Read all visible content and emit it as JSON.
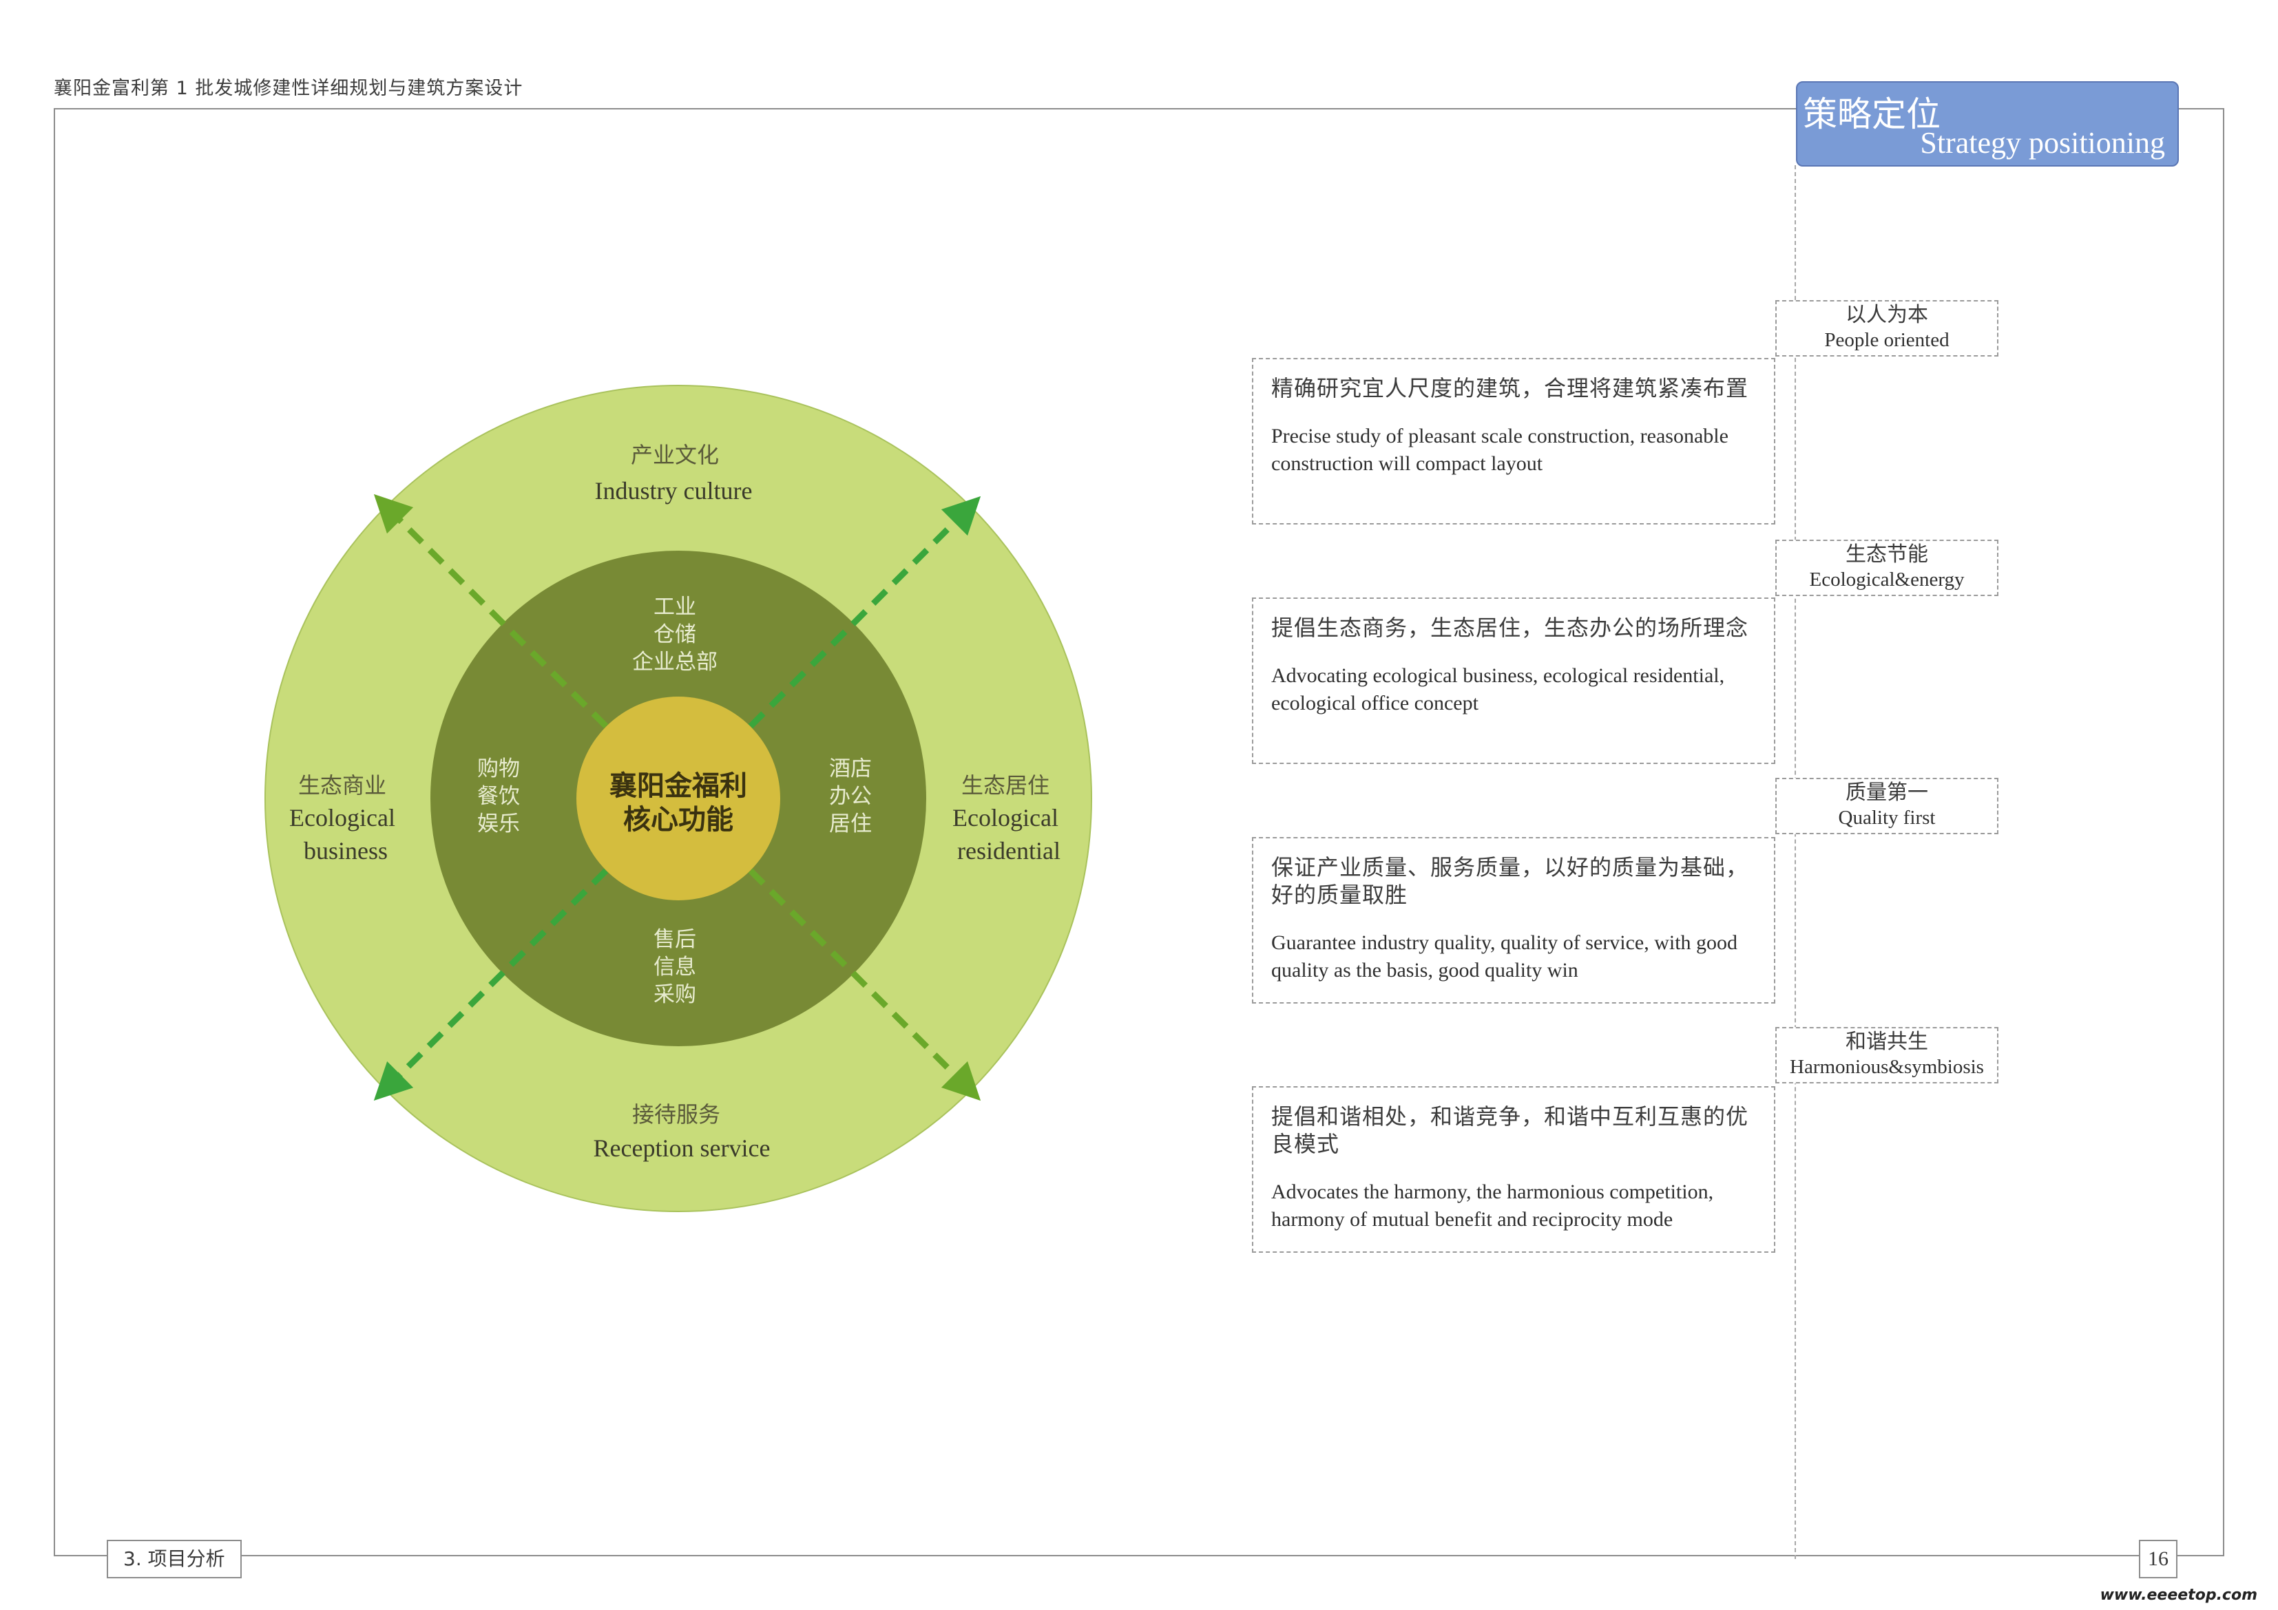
{
  "header": {
    "title": "襄阳金富利第 1 批发城修建性详细规划与建筑方案设计"
  },
  "strategy": {
    "title_cn": "策略定位",
    "title_en": "Strategy positioning"
  },
  "colors": {
    "outer_ring": "#c8dc7a",
    "middle_ring": "#788a35",
    "core": "#d4bd3e",
    "arrow_light": "#6aa82a",
    "arrow_bright": "#3aa63c",
    "strategy_bg": "#7a9bd6"
  },
  "diagram": {
    "core": {
      "line1": "襄阳金福利",
      "line2": "核心功能"
    },
    "outer": {
      "top": {
        "cn": "产业文化",
        "en": "Industry culture"
      },
      "left": {
        "cn": "生态商业",
        "en1": "Ecological",
        "en2": "business"
      },
      "right": {
        "cn": "生态居住",
        "en1": "Ecological",
        "en2": "residential"
      },
      "bottom": {
        "cn": "接待服务",
        "en": "Reception service"
      }
    },
    "middle": {
      "top": [
        "工业",
        "仓储",
        "企业总部"
      ],
      "left": [
        "购物",
        "餐饮",
        "娱乐"
      ],
      "right": [
        "酒店",
        "办公",
        "居住"
      ],
      "bottom": [
        "售后",
        "信息",
        "采购"
      ]
    }
  },
  "strategies": [
    {
      "cat_cn": "以人为本",
      "cat_en": "People oriented",
      "desc_cn": "精确研究宜人尺度的建筑，合理将建筑紧凑布置",
      "desc_en": "Precise study of pleasant scale construction, reasonable construction will compact layout"
    },
    {
      "cat_cn": "生态节能",
      "cat_en": "Ecological&energy",
      "desc_cn": "提倡生态商务，生态居住，生态办公的场所理念",
      "desc_en": "Advocating ecological business, ecological residential, ecological office concept"
    },
    {
      "cat_cn": "质量第一",
      "cat_en": "Quality first",
      "desc_cn": "保证产业质量、服务质量，以好的质量为基础，好的质量取胜",
      "desc_en": "Guarantee industry quality, quality of service, with good quality as the basis, good quality win"
    },
    {
      "cat_cn": "和谐共生",
      "cat_en": "Harmonious&symbiosis",
      "desc_cn": "提倡和谐相处，和谐竞争，和谐中互利互惠的优良模式",
      "desc_en": "Advocates the harmony, the harmonious competition, harmony of mutual benefit and reciprocity mode"
    }
  ],
  "footer": {
    "section": "3. 项目分析",
    "page": "16",
    "watermark": "www.eeeetop.com"
  }
}
